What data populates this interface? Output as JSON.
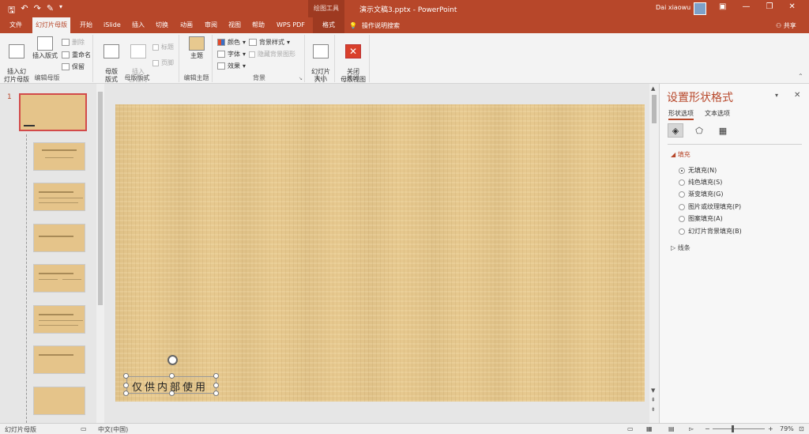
{
  "titlebar": {
    "context_tools": "绘图工具",
    "document_title": "演示文稿3.pptx - PowerPoint",
    "user_name": "Dai xiaowu"
  },
  "tabs": [
    {
      "label": "文件"
    },
    {
      "label": "幻灯片母版"
    },
    {
      "label": "开始"
    },
    {
      "label": "iSlide"
    },
    {
      "label": "插入"
    },
    {
      "label": "切换"
    },
    {
      "label": "动画"
    },
    {
      "label": "审阅"
    },
    {
      "label": "视图"
    },
    {
      "label": "帮助"
    },
    {
      "label": "WPS PDF"
    },
    {
      "label": "格式"
    }
  ],
  "help_search": "操作说明搜索",
  "share_label": "共享",
  "ribbon": {
    "edit_master": {
      "label": "编辑母版",
      "insert_slide_master": "插入幻\n灯片母版",
      "insert_layout": "插入版式",
      "delete": "删除",
      "rename": "重命名",
      "preserve": "保留"
    },
    "master_layout": {
      "label": "母版版式",
      "master_layout_btn": "母版\n版式",
      "insert_placeholder": "插入\n占位符",
      "title_chk": "标题",
      "footer_chk": "页脚"
    },
    "edit_theme": {
      "label": "编辑主题",
      "theme_btn": "主题"
    },
    "background": {
      "label": "背景",
      "colors": "颜色",
      "fonts": "字体",
      "effects": "效果",
      "background_styles": "背景样式",
      "hide_bg_graphics": "隐藏背景图形"
    },
    "size": {
      "label": "大小",
      "slide_size": "幻灯片\n大小"
    },
    "close": {
      "label": "关闭",
      "close_master_view": "关闭\n母版视图"
    }
  },
  "thumbnails": {
    "first_number": "1"
  },
  "slide": {
    "textbox_text": "仅供内部使用"
  },
  "format_pane": {
    "title": "设置形状格式",
    "tab_shape_options": "形状选项",
    "tab_text_options": "文本选项",
    "section_fill": "填充",
    "fill_options": [
      {
        "label": "无填充(N)",
        "selected": true
      },
      {
        "label": "纯色填充(S)",
        "selected": false
      },
      {
        "label": "渐变填充(G)",
        "selected": false
      },
      {
        "label": "图片或纹理填充(P)",
        "selected": false
      },
      {
        "label": "图案填充(A)",
        "selected": false
      },
      {
        "label": "幻灯片背景填充(B)",
        "selected": false
      }
    ],
    "section_line": "线条"
  },
  "statusbar": {
    "view_name": "幻灯片母版",
    "language": "中文(中国)",
    "zoom": "79%"
  },
  "colors": {
    "accent": "#b7472a",
    "slide_texture": "#e7c98f"
  }
}
